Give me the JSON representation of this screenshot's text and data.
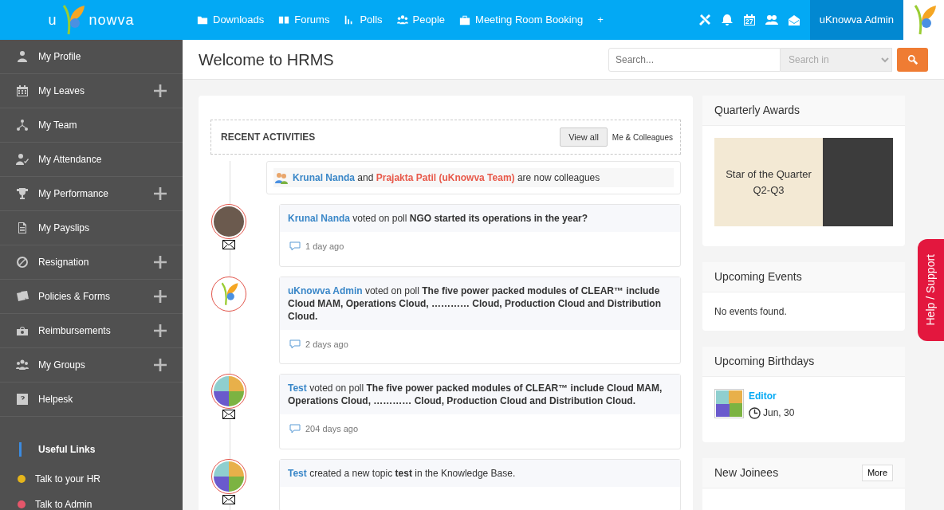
{
  "logo": {
    "left": "u",
    "right": "nowva"
  },
  "nav": [
    {
      "label": "Downloads"
    },
    {
      "label": "Forums"
    },
    {
      "label": "Polls"
    },
    {
      "label": "People"
    },
    {
      "label": "Meeting Room Booking"
    },
    {
      "label": "+"
    }
  ],
  "calendar_day": "27",
  "user": "uKnowva Admin",
  "page_title": "Welcome to HRMS",
  "search": {
    "placeholder": "Search...",
    "scope_placeholder": "Search in"
  },
  "sidebar": [
    {
      "label": "My Profile",
      "expandable": false
    },
    {
      "label": "My Leaves",
      "expandable": true
    },
    {
      "label": "My Team",
      "expandable": false
    },
    {
      "label": "My Attendance",
      "expandable": false
    },
    {
      "label": "My Performance",
      "expandable": true
    },
    {
      "label": "My Payslips",
      "expandable": false
    },
    {
      "label": "Resignation",
      "expandable": true
    },
    {
      "label": "Policies & Forms",
      "expandable": true
    },
    {
      "label": "Reimbursements",
      "expandable": true
    },
    {
      "label": "My Groups",
      "expandable": true
    },
    {
      "label": "Helpesk",
      "expandable": false
    }
  ],
  "useful_links": {
    "title": "Useful Links",
    "items": [
      {
        "label": "Talk to your HR",
        "color": "#e5b51b"
      },
      {
        "label": "Talk to Admin",
        "color": "#e6566a"
      }
    ]
  },
  "activities": {
    "title": "RECENT ACTIVITIES",
    "view_all": "View all",
    "filter": "Me & Colleagues",
    "items": [
      {
        "kind": "colleagues",
        "actor": "Krunal Nanda",
        "connector": "and",
        "actor2": "Prajakta Patil (uKnowva Team)",
        "text": "are now colleagues"
      },
      {
        "kind": "post",
        "mail": true,
        "actor": "Krunal Nanda",
        "text": "voted on poll **NGO started its operations in the year?**",
        "time": "1 day ago"
      },
      {
        "kind": "post",
        "mail": false,
        "actor": "uKnowva Admin",
        "text": "voted on poll **The five power packed modules of CLEAR™ include Cloud MAM, Operations Cloud, ………… Cloud, Production Cloud and Distribution Cloud.**",
        "time": "2 days ago"
      },
      {
        "kind": "post",
        "mail": true,
        "actor": "Test",
        "text": "voted on poll **The five power packed modules of CLEAR™ include Cloud MAM, Operations Cloud, ………… Cloud, Production Cloud and Distribution Cloud.**",
        "time": "204 days ago"
      },
      {
        "kind": "post",
        "mail": true,
        "actor": "Test",
        "text": "created a new topic **test** in the Knowledge Base."
      }
    ]
  },
  "awards": {
    "title": "Quarterly Awards",
    "banner_line1": "Star of the Quarter",
    "banner_line2": "Q2-Q3"
  },
  "events": {
    "title": "Upcoming Events",
    "empty": "No events found."
  },
  "birthdays": {
    "title": "Upcoming Birthdays",
    "items": [
      {
        "name": "Editor",
        "date": "Jun, 30"
      }
    ]
  },
  "joinees": {
    "title": "New Joinees",
    "more": "More"
  },
  "help_tab": "Help / Support"
}
